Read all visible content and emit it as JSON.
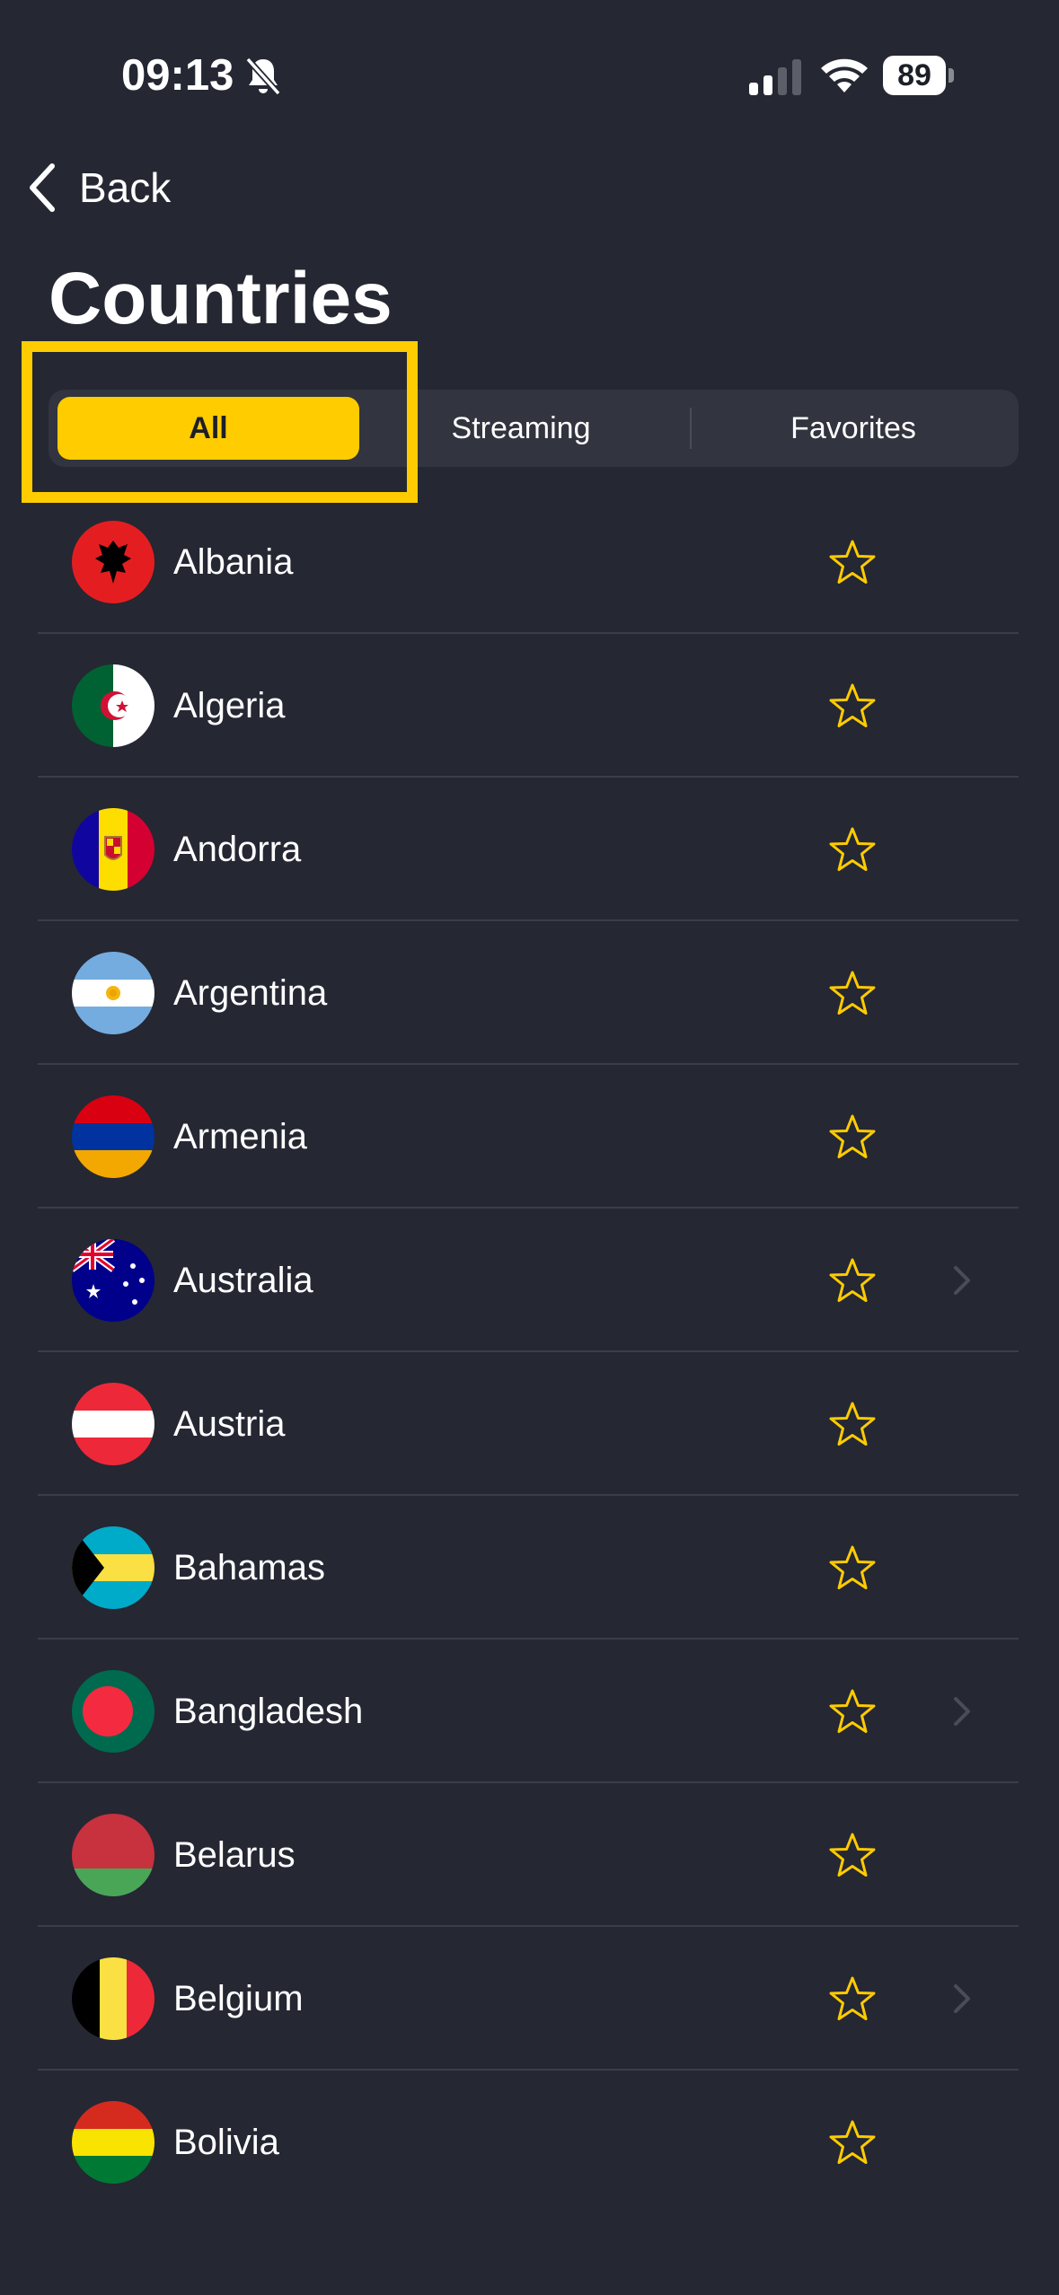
{
  "status": {
    "time": "09:13",
    "battery": "89"
  },
  "nav": {
    "back_label": "Back",
    "title": "Countries"
  },
  "tabs": {
    "all": "All",
    "streaming": "Streaming",
    "favorites": "Favorites",
    "selected": "All"
  },
  "colors": {
    "accent": "#ffcc00",
    "background": "#252733"
  },
  "countries": [
    {
      "name": "Albania",
      "has_chevron": false
    },
    {
      "name": "Algeria",
      "has_chevron": false
    },
    {
      "name": "Andorra",
      "has_chevron": false
    },
    {
      "name": "Argentina",
      "has_chevron": false
    },
    {
      "name": "Armenia",
      "has_chevron": false
    },
    {
      "name": "Australia",
      "has_chevron": true
    },
    {
      "name": "Austria",
      "has_chevron": false
    },
    {
      "name": "Bahamas",
      "has_chevron": false
    },
    {
      "name": "Bangladesh",
      "has_chevron": true
    },
    {
      "name": "Belarus",
      "has_chevron": false
    },
    {
      "name": "Belgium",
      "has_chevron": true
    },
    {
      "name": "Bolivia",
      "has_chevron": false
    }
  ]
}
